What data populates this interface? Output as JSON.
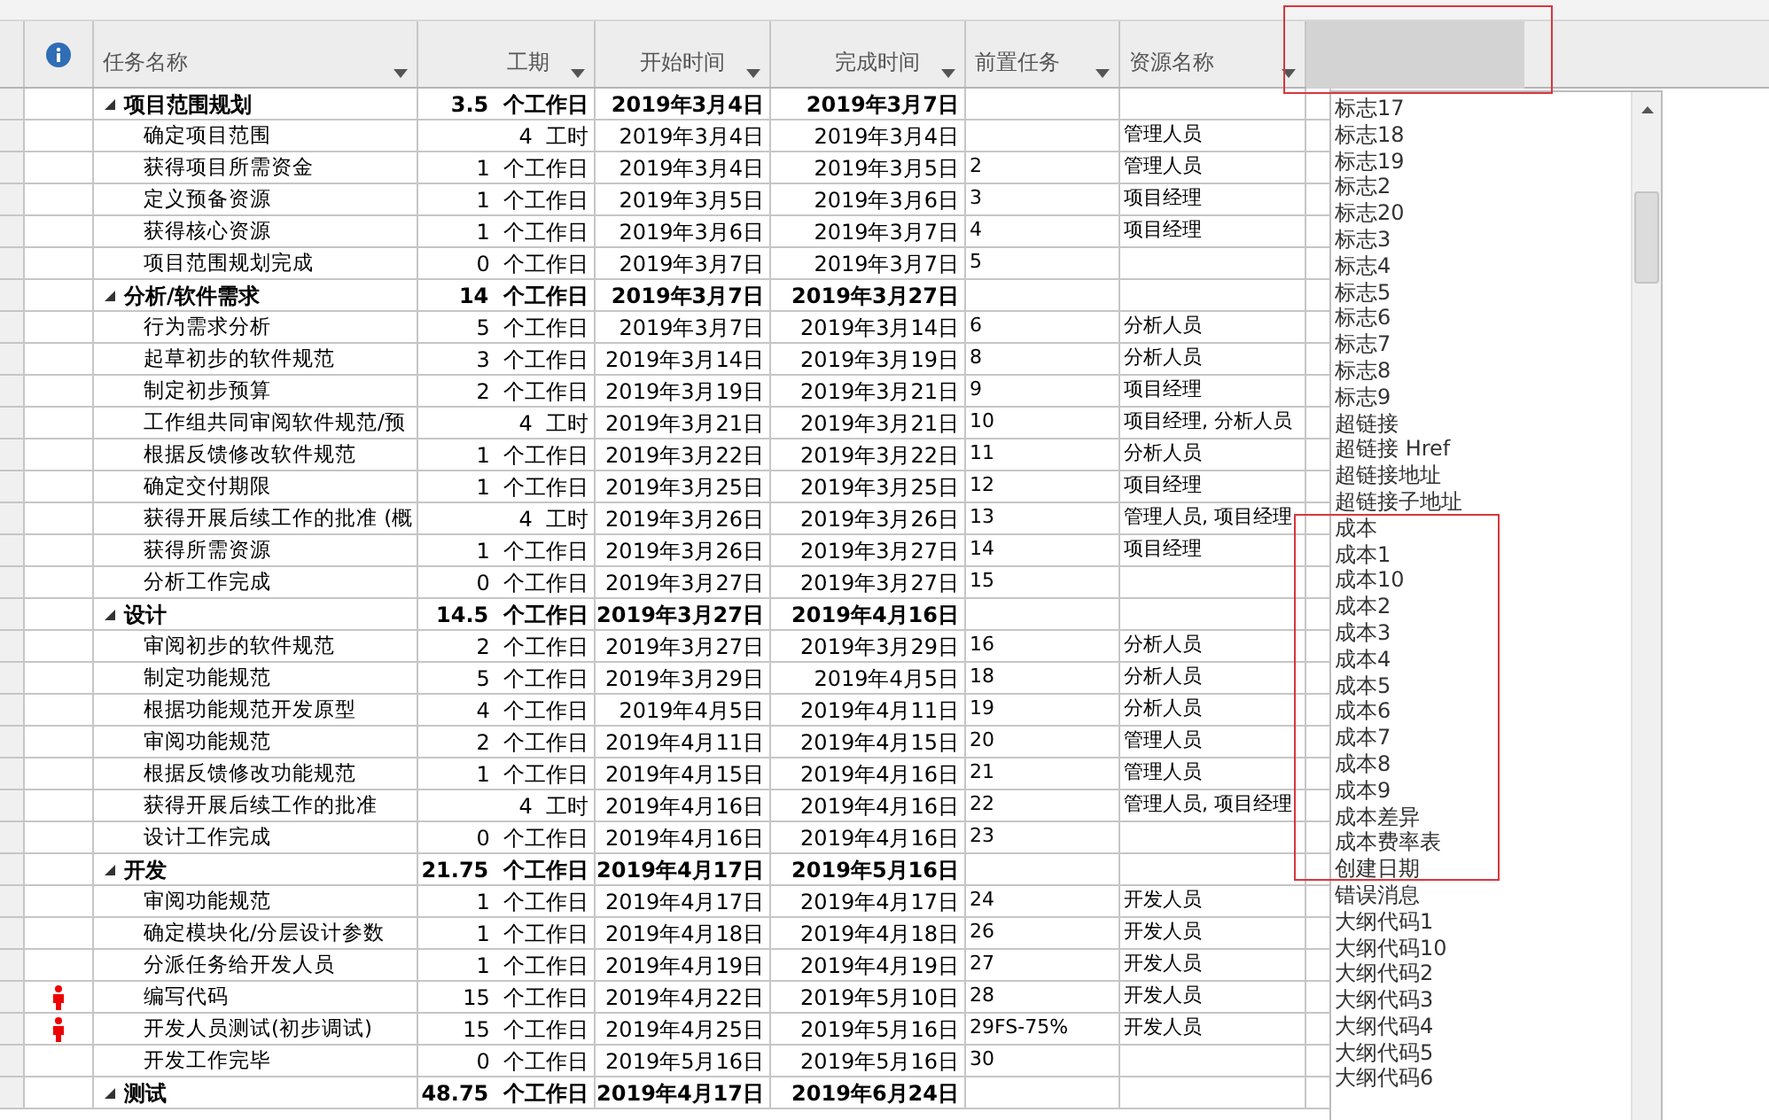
{
  "columns": [
    "任务名称",
    "工期",
    "开始时间",
    "完成时间",
    "前置任务",
    "资源名称"
  ],
  "rows": [
    {
      "kind": "summary",
      "expanded": true,
      "name": "项目范围规划",
      "duration": "3.5  个工作日",
      "start": "2019年3月4日",
      "finish": "2019年3月7日"
    },
    {
      "kind": "task",
      "name": "确定项目范围",
      "duration": "4  工时",
      "start": "2019年3月4日",
      "finish": "2019年3月4日",
      "resources": "管理人员"
    },
    {
      "kind": "task",
      "name": "获得项目所需资金",
      "duration": "1  个工作日",
      "start": "2019年3月4日",
      "finish": "2019年3月5日",
      "predecessors": "2",
      "resources": "管理人员"
    },
    {
      "kind": "task",
      "name": "定义预备资源",
      "duration": "1  个工作日",
      "start": "2019年3月5日",
      "finish": "2019年3月6日",
      "predecessors": "3",
      "resources": "项目经理"
    },
    {
      "kind": "task",
      "name": "获得核心资源",
      "duration": "1  个工作日",
      "start": "2019年3月6日",
      "finish": "2019年3月7日",
      "predecessors": "4",
      "resources": "项目经理"
    },
    {
      "kind": "task",
      "name": "项目范围规划完成",
      "duration": "0  个工作日",
      "start": "2019年3月7日",
      "finish": "2019年3月7日",
      "predecessors": "5"
    },
    {
      "kind": "summary",
      "expanded": true,
      "name": "分析/软件需求",
      "duration": "14  个工作日",
      "start": "2019年3月7日",
      "finish": "2019年3月27日"
    },
    {
      "kind": "task",
      "name": "行为需求分析",
      "duration": "5  个工作日",
      "start": "2019年3月7日",
      "finish": "2019年3月14日",
      "predecessors": "6",
      "resources": "分析人员"
    },
    {
      "kind": "task",
      "name": "起草初步的软件规范",
      "duration": "3  个工作日",
      "start": "2019年3月14日",
      "finish": "2019年3月19日",
      "predecessors": "8",
      "resources": "分析人员"
    },
    {
      "kind": "task",
      "name": "制定初步预算",
      "duration": "2  个工作日",
      "start": "2019年3月19日",
      "finish": "2019年3月21日",
      "predecessors": "9",
      "resources": "项目经理"
    },
    {
      "kind": "task",
      "name": "工作组共同审阅软件规范/预",
      "duration": "4  工时",
      "start": "2019年3月21日",
      "finish": "2019年3月21日",
      "predecessors": "10",
      "resources": "项目经理, 分析人员"
    },
    {
      "kind": "task",
      "name": "根据反馈修改软件规范",
      "duration": "1  个工作日",
      "start": "2019年3月22日",
      "finish": "2019年3月22日",
      "predecessors": "11",
      "resources": "分析人员"
    },
    {
      "kind": "task",
      "name": "确定交付期限",
      "duration": "1  个工作日",
      "start": "2019年3月25日",
      "finish": "2019年3月25日",
      "predecessors": "12",
      "resources": "项目经理"
    },
    {
      "kind": "task",
      "name": "获得开展后续工作的批准 (概",
      "duration": "4  工时",
      "start": "2019年3月26日",
      "finish": "2019年3月26日",
      "predecessors": "13",
      "resources": "管理人员, 项目经理"
    },
    {
      "kind": "task",
      "name": "获得所需资源",
      "duration": "1  个工作日",
      "start": "2019年3月26日",
      "finish": "2019年3月27日",
      "predecessors": "14",
      "resources": "项目经理"
    },
    {
      "kind": "task",
      "name": "分析工作完成",
      "duration": "0  个工作日",
      "start": "2019年3月27日",
      "finish": "2019年3月27日",
      "predecessors": "15"
    },
    {
      "kind": "summary",
      "expanded": true,
      "name": "设计",
      "duration": "14.5  个工作日",
      "start": "2019年3月27日",
      "finish": "2019年4月16日"
    },
    {
      "kind": "task",
      "name": "审阅初步的软件规范",
      "duration": "2  个工作日",
      "start": "2019年3月27日",
      "finish": "2019年3月29日",
      "predecessors": "16",
      "resources": "分析人员"
    },
    {
      "kind": "task",
      "name": "制定功能规范",
      "duration": "5  个工作日",
      "start": "2019年3月29日",
      "finish": "2019年4月5日",
      "predecessors": "18",
      "resources": "分析人员"
    },
    {
      "kind": "task",
      "name": "根据功能规范开发原型",
      "duration": "4  个工作日",
      "start": "2019年4月5日",
      "finish": "2019年4月11日",
      "predecessors": "19",
      "resources": "分析人员"
    },
    {
      "kind": "task",
      "name": "审阅功能规范",
      "duration": "2  个工作日",
      "start": "2019年4月11日",
      "finish": "2019年4月15日",
      "predecessors": "20",
      "resources": "管理人员"
    },
    {
      "kind": "task",
      "name": "根据反馈修改功能规范",
      "duration": "1  个工作日",
      "start": "2019年4月15日",
      "finish": "2019年4月16日",
      "predecessors": "21",
      "resources": "管理人员"
    },
    {
      "kind": "task",
      "name": "获得开展后续工作的批准",
      "duration": "4  工时",
      "start": "2019年4月16日",
      "finish": "2019年4月16日",
      "predecessors": "22",
      "resources": "管理人员, 项目经理"
    },
    {
      "kind": "task",
      "name": "设计工作完成",
      "duration": "0  个工作日",
      "start": "2019年4月16日",
      "finish": "2019年4月16日",
      "predecessors": "23"
    },
    {
      "kind": "summary",
      "expanded": true,
      "name": "开发",
      "duration": "21.75  个工作日",
      "start": "2019年4月17日",
      "finish": "2019年5月16日"
    },
    {
      "kind": "task",
      "name": "审阅功能规范",
      "duration": "1  个工作日",
      "start": "2019年4月17日",
      "finish": "2019年4月17日",
      "predecessors": "24",
      "resources": "开发人员"
    },
    {
      "kind": "task",
      "name": "确定模块化/分层设计参数",
      "duration": "1  个工作日",
      "start": "2019年4月18日",
      "finish": "2019年4月18日",
      "predecessors": "26",
      "resources": "开发人员"
    },
    {
      "kind": "task",
      "name": "分派任务给开发人员",
      "duration": "1  个工作日",
      "start": "2019年4月19日",
      "finish": "2019年4月19日",
      "predecessors": "27",
      "resources": "开发人员"
    },
    {
      "kind": "task",
      "overallocated": true,
      "name": "编写代码",
      "duration": "15  个工作日",
      "start": "2019年4月22日",
      "finish": "2019年5月10日",
      "predecessors": "28",
      "resources": "开发人员"
    },
    {
      "kind": "task",
      "overallocated": true,
      "name": "开发人员测试(初步调试)",
      "duration": "15  个工作日",
      "start": "2019年4月25日",
      "finish": "2019年5月16日",
      "predecessors": "29FS-75%",
      "resources": "开发人员"
    },
    {
      "kind": "task",
      "name": "开发工作完毕",
      "duration": "0  个工作日",
      "start": "2019年5月16日",
      "finish": "2019年5月16日",
      "predecessors": "30"
    },
    {
      "kind": "summary",
      "expanded": true,
      "name": "测试",
      "duration": "48.75  个工作日",
      "start": "2019年4月17日",
      "finish": "2019年6月24日"
    }
  ],
  "field_list": [
    "标志17",
    "标志18",
    "标志19",
    "标志2",
    "标志20",
    "标志3",
    "标志4",
    "标志5",
    "标志6",
    "标志7",
    "标志8",
    "标志9",
    "超链接",
    "超链接 Href",
    "超链接地址",
    "超链接子地址",
    "成本",
    "成本1",
    "成本10",
    "成本2",
    "成本3",
    "成本4",
    "成本5",
    "成本6",
    "成本7",
    "成本8",
    "成本9",
    "成本差异",
    "成本费率表",
    "创建日期",
    "错误消息",
    "大纲代码1",
    "大纲代码10",
    "大纲代码2",
    "大纲代码3",
    "大纲代码4",
    "大纲代码5",
    "大纲代码6"
  ]
}
